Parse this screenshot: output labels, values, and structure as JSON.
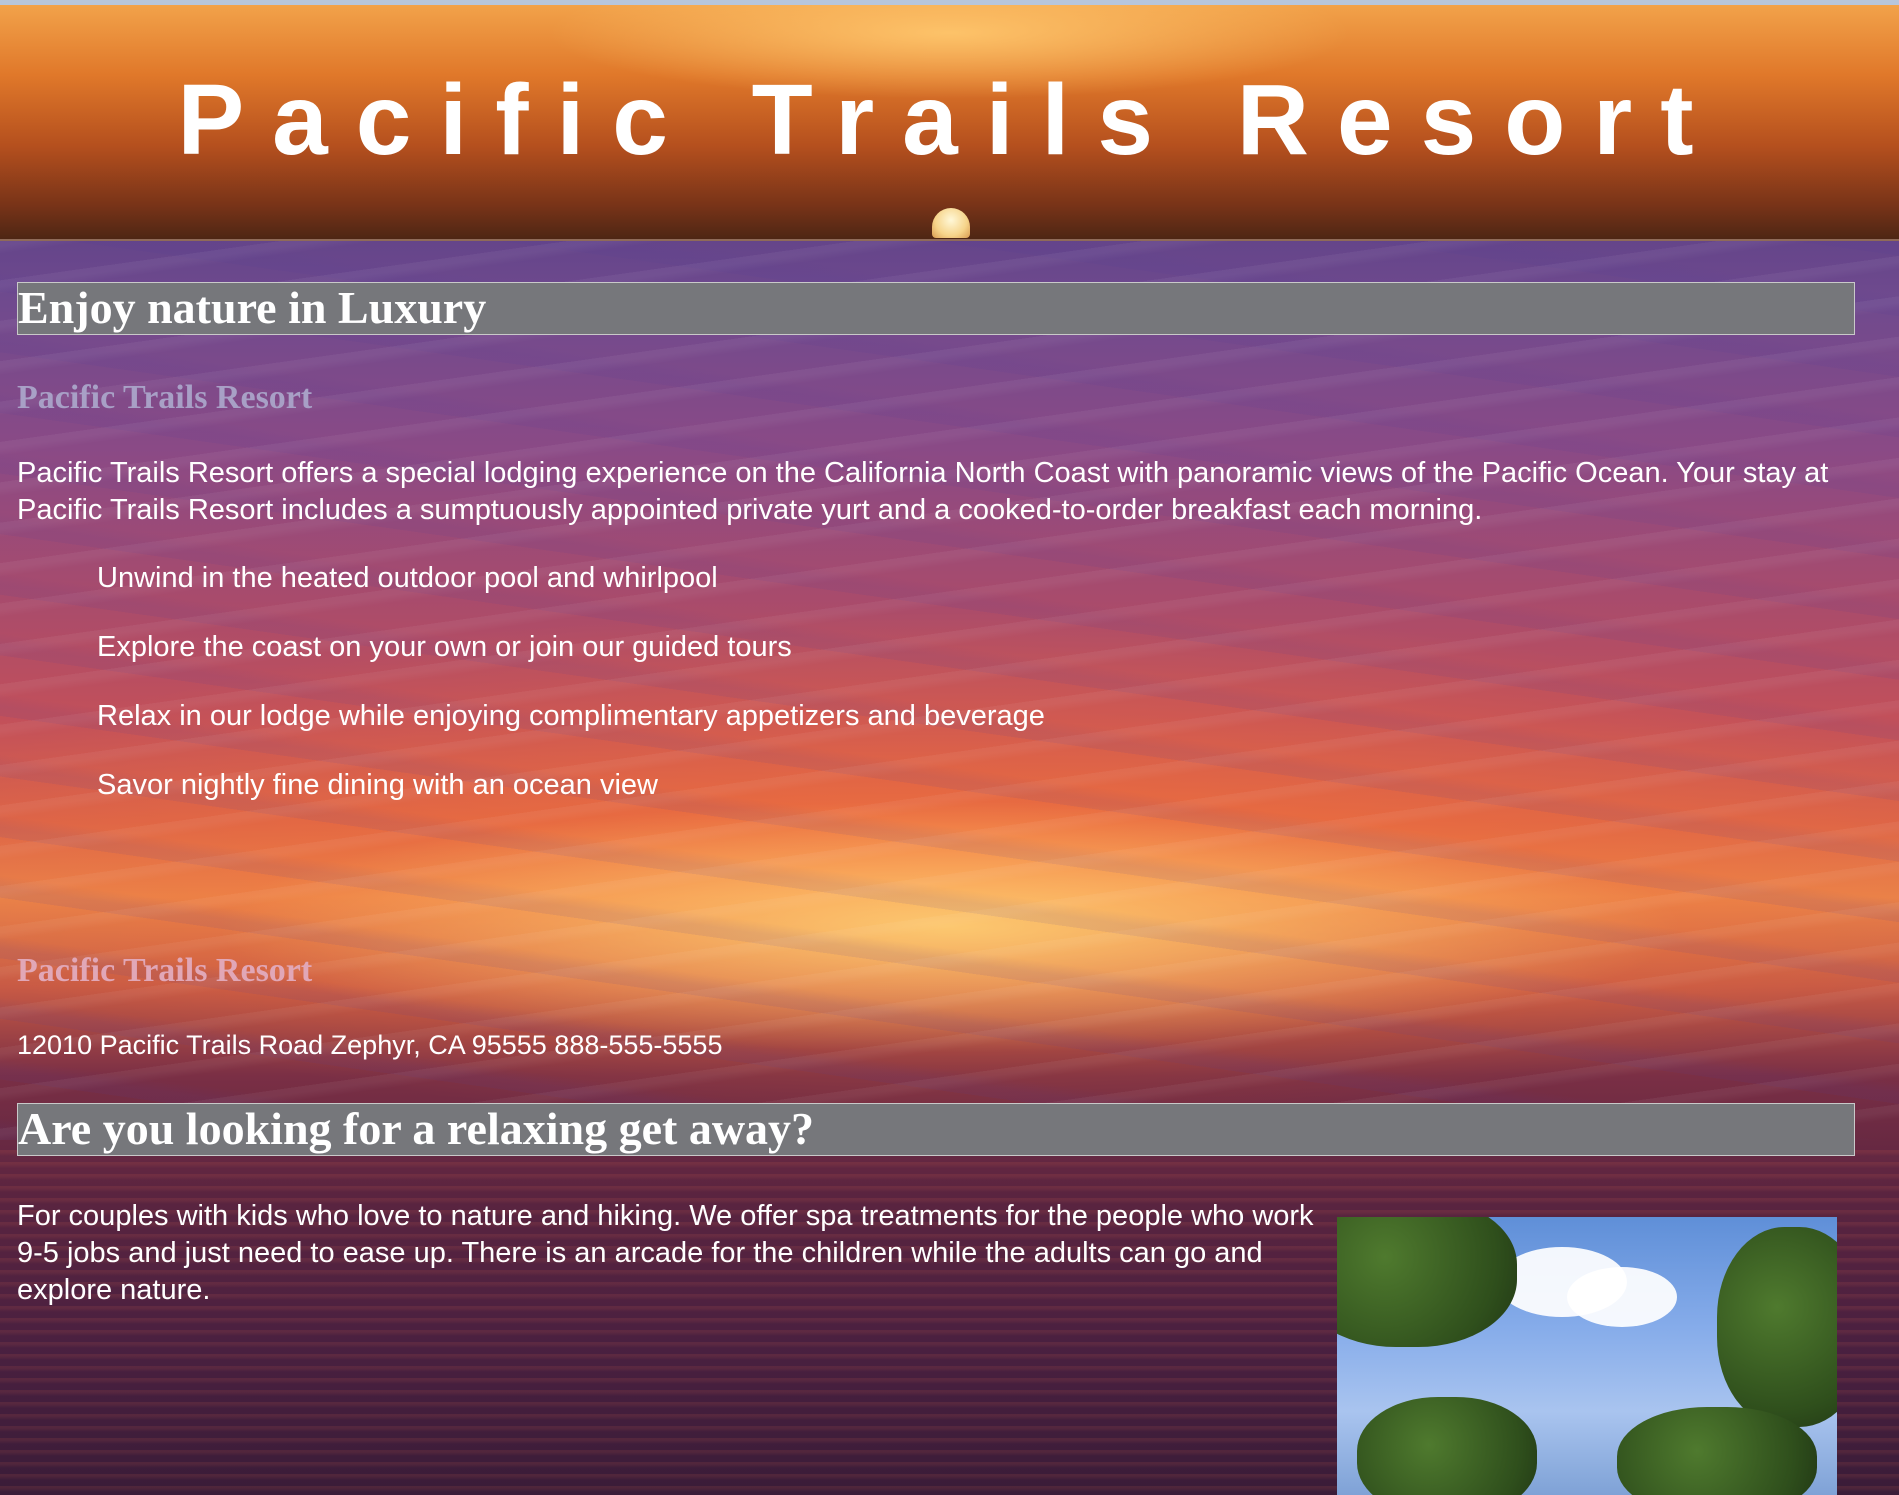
{
  "site": {
    "title": "Pacific Trails Resort"
  },
  "section1": {
    "heading": "Enjoy nature in Luxury",
    "subheading": "Pacific Trails Resort",
    "intro": "Pacific Trails Resort offers a special lodging experience on the California North Coast with panoramic views of the Pacific Ocean. Your stay at Pacific Trails Resort includes a sumptuously appointed private yurt and a cooked-to-order breakfast each morning.",
    "features": [
      "Unwind in the heated outdoor pool and whirlpool",
      "Explore the coast on your own or join our guided tours",
      "Relax in our lodge while enjoying complimentary appetizers and beverage",
      "Savor nightly fine dining with an ocean view"
    ]
  },
  "contact": {
    "name": "Pacific Trails Resort",
    "address": "12010 Pacific Trails Road Zephyr, CA 95555 888-555-5555"
  },
  "section2": {
    "heading": "Are you looking for a relaxing get away?",
    "body": "For couples with kids who love to nature and hiking. We offer spa treatments for the people who work 9-5 jobs and just need to ease up. There is an arcade for the children while the adults can go and explore nature."
  },
  "colors": {
    "heading_bar": "#76777b",
    "subheading_upper": "#a8a0c6",
    "subheading_lower": "#e1a7b7",
    "text": "#ffffff"
  }
}
